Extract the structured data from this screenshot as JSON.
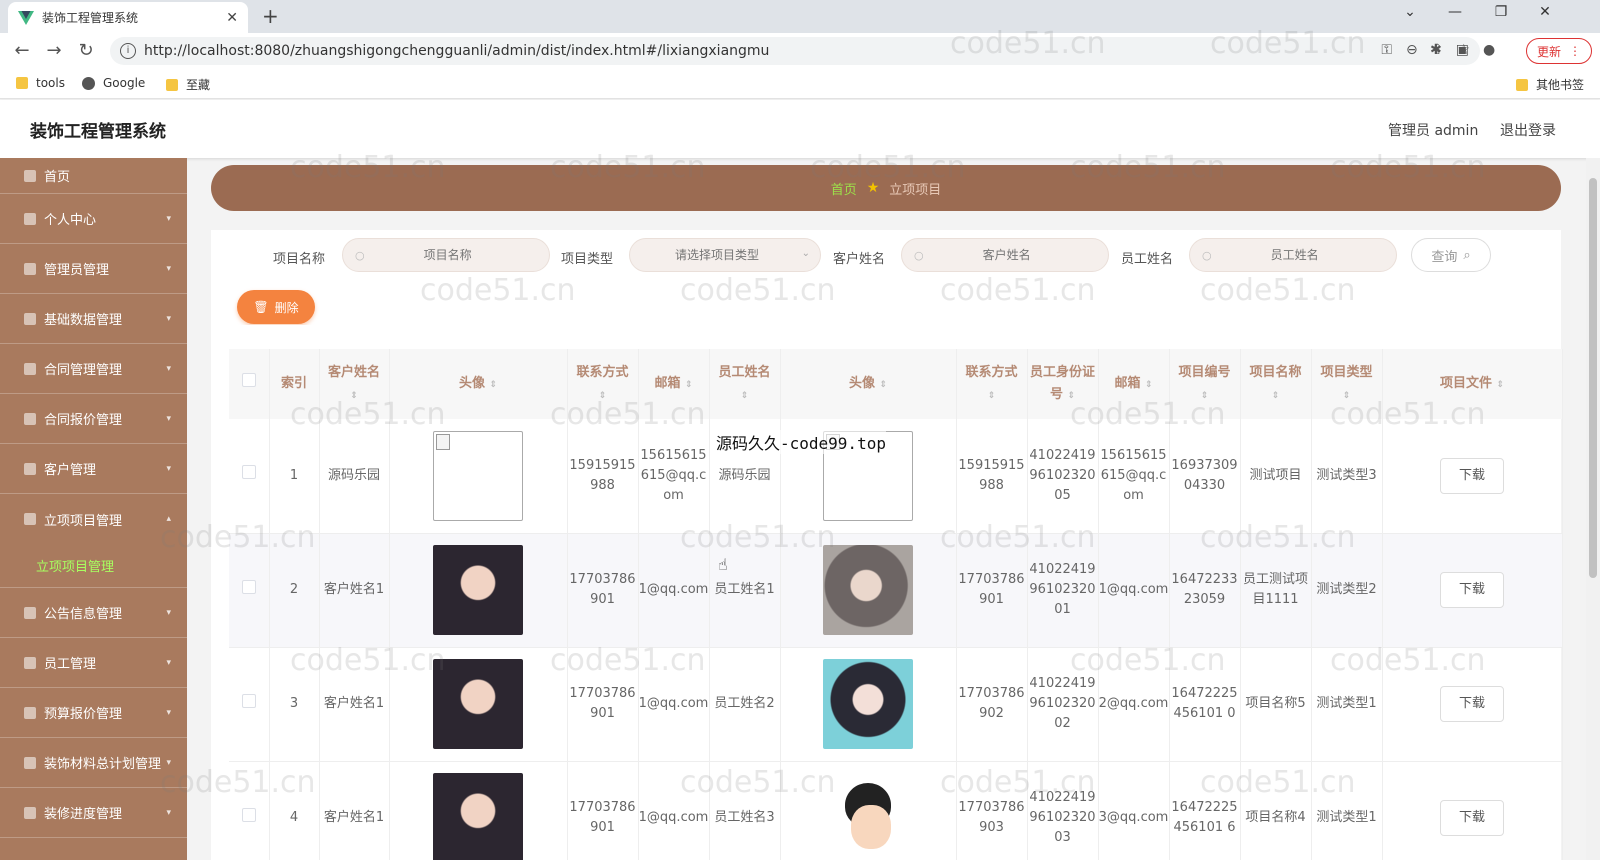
{
  "browser": {
    "tab_title": "装饰工程管理系统",
    "url": "http://localhost:8080/zhuangshigongchengguanli/admin/dist/index.html#/lixiangxiangmu",
    "update_label": "更新",
    "bookmarks": [
      "tools",
      "Google",
      "至藏"
    ],
    "other_bookmarks": "其他书签"
  },
  "header": {
    "title": "装饰工程管理系统",
    "admin_label": "管理员 admin",
    "logout_label": "退出登录"
  },
  "sidebar": {
    "items": [
      {
        "label": "首页"
      },
      {
        "label": "个人中心"
      },
      {
        "label": "管理员管理"
      },
      {
        "label": "基础数据管理"
      },
      {
        "label": "合同管理管理"
      },
      {
        "label": "合同报价管理"
      },
      {
        "label": "客户管理"
      },
      {
        "label": "立项项目管理"
      },
      {
        "label": "公告信息管理"
      },
      {
        "label": "员工管理"
      },
      {
        "label": "预算报价管理"
      },
      {
        "label": "装饰材料总计划管理"
      },
      {
        "label": "装修进度管理"
      }
    ],
    "active_sub": "立项项目管理"
  },
  "breadcrumb": {
    "home": "首页",
    "current": "立项项目"
  },
  "search": {
    "project_name_label": "项目名称",
    "project_name_placeholder": "项目名称",
    "project_type_label": "项目类型",
    "project_type_placeholder": "请选择项目类型",
    "customer_name_label": "客户姓名",
    "customer_name_placeholder": "客户姓名",
    "employee_name_label": "员工姓名",
    "employee_name_placeholder": "员工姓名",
    "query_label": "查询",
    "delete_label": "删除"
  },
  "table": {
    "headers": {
      "index": "索引",
      "customer_name": "客户姓名",
      "customer_avatar": "头像",
      "customer_phone": "联系方式",
      "customer_email": "邮箱",
      "employee_name": "员工姓名",
      "employee_avatar": "头像",
      "employee_phone": "联系方式",
      "employee_id": "员工身份证号",
      "employee_email": "邮箱",
      "project_no": "项目编号",
      "project_name": "项目名称",
      "project_type": "项目类型",
      "project_file": "项目文件"
    },
    "download_label": "下载",
    "rows": [
      {
        "index": "1",
        "customer_name": "源码乐园",
        "customer_phone": "15915915988",
        "customer_email": "15615615615@qq.com",
        "employee_name": "源码乐园",
        "employee_phone": "15915915988",
        "employee_id": "410224199610232005",
        "employee_email": "15615615615@qq.com",
        "project_no": "1693730904330",
        "project_name": "测试项目",
        "project_type": "测试类型3"
      },
      {
        "index": "2",
        "customer_name": "客户姓名1",
        "customer_phone": "17703786901",
        "customer_email": "1@qq.com",
        "employee_name": "员工姓名1",
        "employee_phone": "17703786901",
        "employee_id": "410224199610232001",
        "employee_email": "1@qq.com",
        "project_no": "1647223323059",
        "project_name": "员工测试项目1111",
        "project_type": "测试类型2"
      },
      {
        "index": "3",
        "customer_name": "客户姓名1",
        "customer_phone": "17703786901",
        "customer_email": "1@qq.com",
        "employee_name": "员工姓名2",
        "employee_phone": "17703786902",
        "employee_id": "410224199610232002",
        "employee_email": "2@qq.com",
        "project_no": "16472225456101 0",
        "project_name": "项目名称5",
        "project_type": "测试类型1"
      },
      {
        "index": "4",
        "customer_name": "客户姓名1",
        "customer_phone": "17703786901",
        "customer_email": "1@qq.com",
        "employee_name": "员工姓名3",
        "employee_phone": "17703786903",
        "employee_id": "410224199610232003",
        "employee_email": "3@qq.com",
        "project_no": "16472225456101 6",
        "project_name": "项目名称4",
        "project_type": "测试类型1"
      }
    ]
  },
  "overlay_text": "源码久久-code99.top",
  "watermark": "code51.cn",
  "colors": {
    "sidebar_bg": "#a97a5e",
    "breadcrumb_bg": "#9b6b52",
    "accent_green": "#9de14a",
    "delete_orange": "#f4833f",
    "header_text": "#b58a74"
  }
}
